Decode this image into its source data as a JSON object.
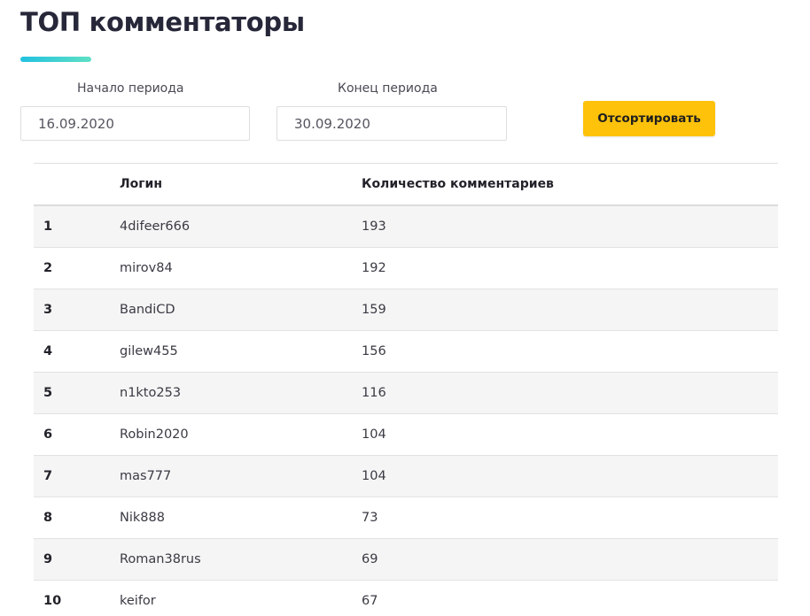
{
  "page": {
    "title": "ТОП комментаторы"
  },
  "filters": {
    "start_label": "Начало периода",
    "start_value": "16.09.2020",
    "end_label": "Конец периода",
    "end_value": "30.09.2020",
    "sort_button": "Отсортировать"
  },
  "table": {
    "headers": {
      "number": "",
      "login": "Логин",
      "count": "Количество комментариев"
    },
    "rows": [
      {
        "rank": "1",
        "login": "4difeer666",
        "count": "193"
      },
      {
        "rank": "2",
        "login": "mirov84",
        "count": "192"
      },
      {
        "rank": "3",
        "login": "BandiCD",
        "count": "159"
      },
      {
        "rank": "4",
        "login": "gilew455",
        "count": "156"
      },
      {
        "rank": "5",
        "login": "n1kto253",
        "count": "116"
      },
      {
        "rank": "6",
        "login": "Robin2020",
        "count": "104"
      },
      {
        "rank": "7",
        "login": "mas777",
        "count": "104"
      },
      {
        "rank": "8",
        "login": "Nik888",
        "count": "73"
      },
      {
        "rank": "9",
        "login": "Roman38rus",
        "count": "69"
      },
      {
        "rank": "10",
        "login": "keifor",
        "count": "67"
      }
    ]
  },
  "colors": {
    "accent_button": "#fec20b",
    "underline_start": "#22c1e0",
    "underline_end": "#5fe0c4"
  }
}
